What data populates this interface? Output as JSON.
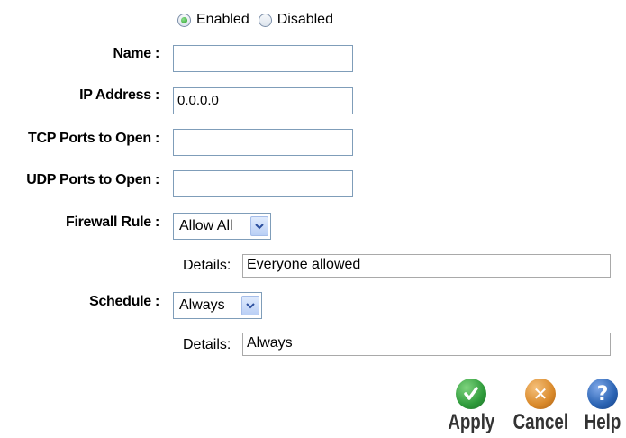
{
  "status": {
    "enabled_label": "Enabled",
    "disabled_label": "Disabled",
    "selected": "Enabled"
  },
  "form": {
    "name_label": "Name :",
    "name_value": "",
    "ip_label": "IP Address :",
    "ip_value": "0.0.0.0",
    "tcp_label": "TCP Ports to Open :",
    "tcp_value": "",
    "udp_label": "UDP Ports to Open :",
    "udp_value": "",
    "firewall_label": "Firewall Rule :",
    "firewall_selected": "Allow All",
    "firewall_details_label": "Details:",
    "firewall_details_value": "Everyone allowed",
    "schedule_label": "Schedule :",
    "schedule_selected": "Always",
    "schedule_details_label": "Details:",
    "schedule_details_value": "Always"
  },
  "actions": {
    "apply_label": "Apply",
    "cancel_label": "Cancel",
    "help_label": "Help",
    "apply_color": "#2e9a3a",
    "cancel_color": "#d9892a",
    "help_color": "#2a63b3"
  }
}
